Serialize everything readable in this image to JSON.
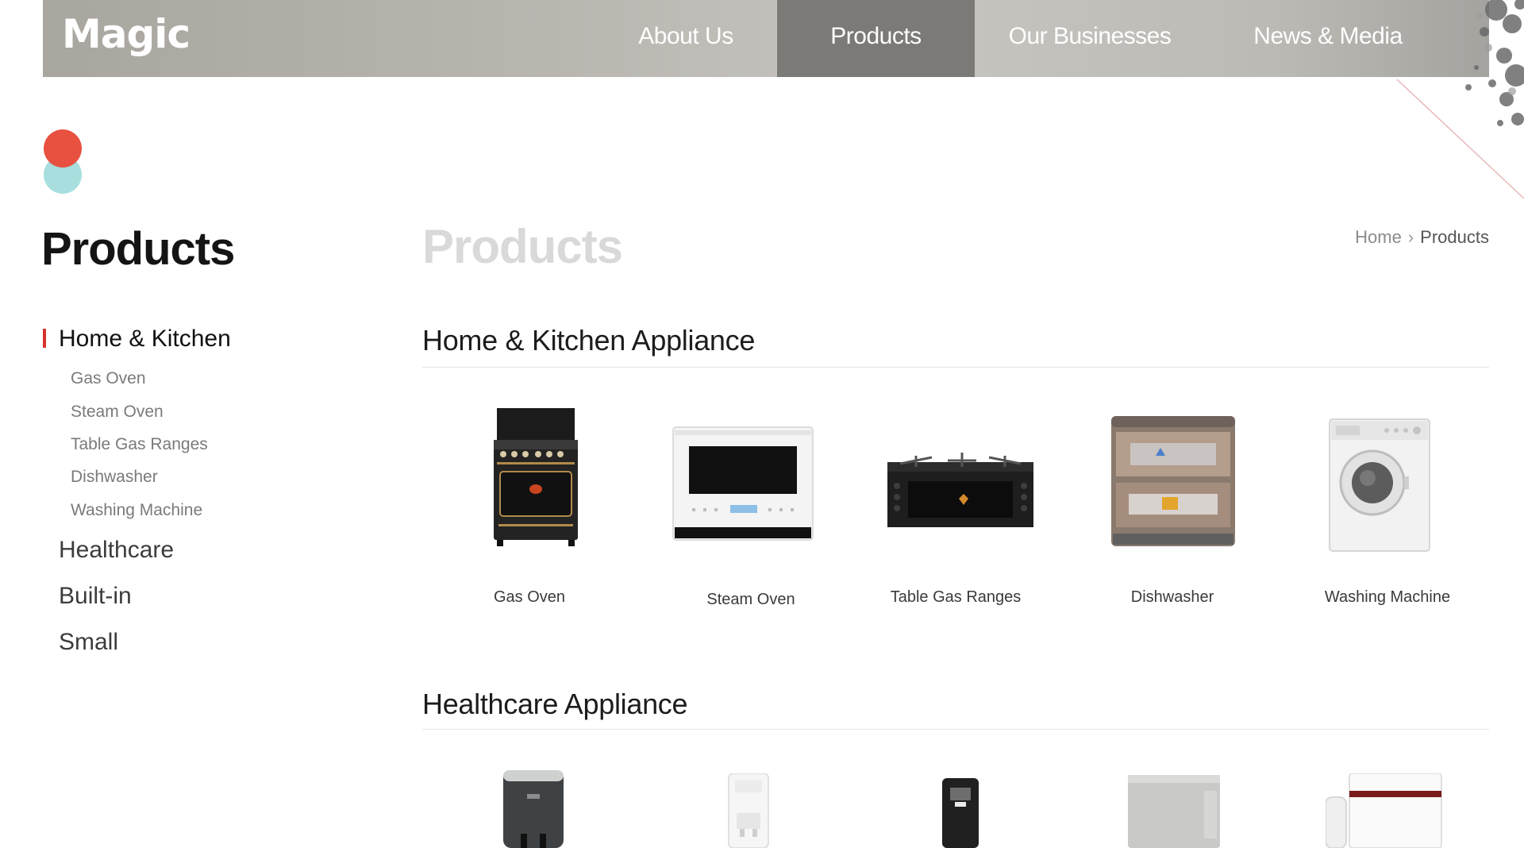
{
  "header": {
    "logo": "Magic",
    "nav": [
      {
        "label": "About Us",
        "active": false
      },
      {
        "label": "Products",
        "active": true
      },
      {
        "label": "Our Businesses",
        "active": false
      },
      {
        "label": "News & Media",
        "active": false
      }
    ]
  },
  "sidebar": {
    "title": "Products",
    "categories": [
      {
        "label": "Home & Kitchen",
        "active": true,
        "items": [
          "Gas Oven",
          "Steam Oven",
          "Table Gas Ranges",
          "Dishwasher",
          "Washing Machine"
        ]
      },
      {
        "label": "Healthcare",
        "active": false
      },
      {
        "label": "Built-in",
        "active": false
      },
      {
        "label": "Small",
        "active": false
      }
    ]
  },
  "main": {
    "title": "Products",
    "breadcrumb": {
      "home": "Home",
      "current": "Products"
    },
    "sections": [
      {
        "title": "Home & Kitchen Appliance",
        "products": [
          "Gas Oven",
          "Steam Oven",
          "Table Gas Ranges",
          "Dishwasher",
          "Washing Machine"
        ]
      },
      {
        "title": "Healthcare Appliance",
        "products": []
      }
    ]
  },
  "colors": {
    "accent": "#d8322d",
    "nav_active": "#7c7a77",
    "dot_top": "#e8503f",
    "dot_bottom": "#a8dede"
  }
}
